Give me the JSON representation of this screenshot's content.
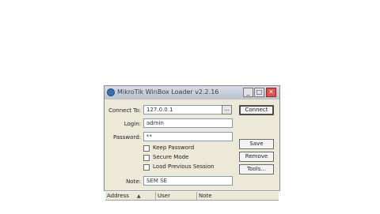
{
  "window": {
    "title": "MikroTik WinBox Loader v2.2.16",
    "controls": {
      "minimize": "_",
      "maximize": "□",
      "close": "✕"
    }
  },
  "form": {
    "connect_to": {
      "label": "Connect To:",
      "value": "127.0.0.1",
      "browse": "..."
    },
    "login": {
      "label": "Login:",
      "value": "admin"
    },
    "password": {
      "label": "Password:",
      "value": "**"
    },
    "checkboxes": [
      {
        "label": "Keep Password",
        "checked": false
      },
      {
        "label": "Secure Mode",
        "checked": false
      },
      {
        "label": "Load Previous Session",
        "checked": false
      }
    ],
    "note": {
      "label": "Note:",
      "value": "SEM SE"
    }
  },
  "buttons": {
    "connect": "Connect",
    "save": "Save",
    "remove": "Remove",
    "tools": "Tools..."
  },
  "table": {
    "columns": [
      "Address",
      "User",
      "Note"
    ],
    "sort_indicator": "▲"
  }
}
